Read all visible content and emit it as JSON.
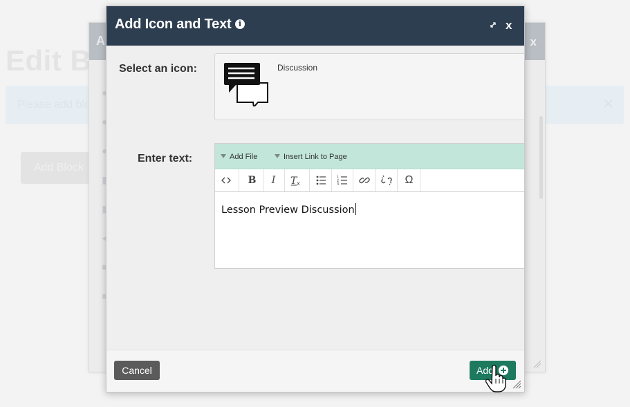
{
  "background": {
    "page_title": "Edit Bo",
    "alert_text": "Please add blo",
    "add_block_label": "Add Block"
  },
  "back_dialog": {
    "title_initial": "A",
    "close_label": "x"
  },
  "dialog": {
    "title": "Add Icon and Text",
    "close_label": "x",
    "select_icon_label": "Select an icon:",
    "selected_icon_name": "Discussion",
    "enter_text_label": "Enter text:",
    "editor": {
      "add_file_label": "Add File",
      "insert_link_label": "Insert Link to Page",
      "content": "Lesson Preview Discussion",
      "toolbar": [
        "source-code",
        "bold",
        "italic",
        "remove-format",
        "bulleted-list",
        "numbered-list",
        "link",
        "unlink",
        "special-character"
      ]
    },
    "cancel_label": "Cancel",
    "add_label": "Add"
  },
  "colors": {
    "header": "#2d3e50",
    "editor_bar": "#c2e6da",
    "add_button": "#1d7a5f",
    "cancel_button": "#5b5b5b"
  }
}
